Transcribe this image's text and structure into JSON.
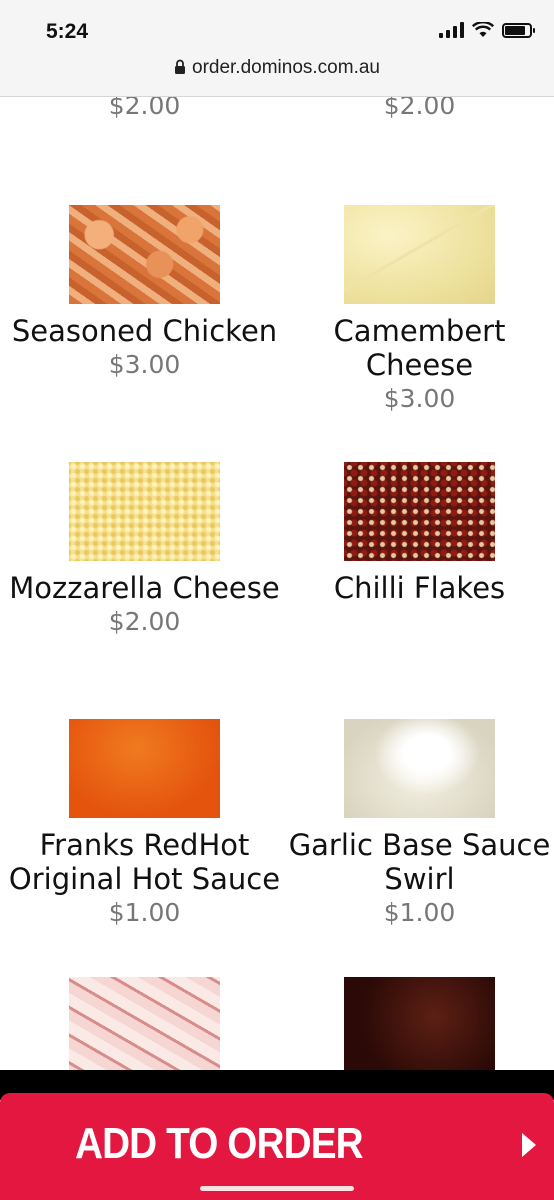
{
  "status_bar": {
    "time": "5:24"
  },
  "browser": {
    "url": "order.dominos.com.au"
  },
  "top_prices": {
    "left": "$2.00",
    "right": "$2.00"
  },
  "toppings": [
    {
      "name": "Seasoned Chicken",
      "price": "$3.00",
      "icon": "seasoned-chicken-image"
    },
    {
      "name": "Camembert Cheese",
      "price": "$3.00",
      "icon": "camembert-cheese-image"
    },
    {
      "name": "Mozzarella Cheese",
      "price": "$2.00",
      "icon": "mozzarella-cheese-image"
    },
    {
      "name": "Chilli Flakes",
      "price": "",
      "icon": "chilli-flakes-image"
    },
    {
      "name": "Franks RedHot Original Hot Sauce",
      "price": "$1.00",
      "icon": "franks-hot-sauce-image"
    },
    {
      "name": "Garlic Base Sauce Swirl",
      "price": "$1.00",
      "icon": "garlic-sauce-image"
    },
    {
      "name": "",
      "price": "",
      "icon": "ham-image"
    },
    {
      "name": "",
      "price": "",
      "icon": "dark-topping-image"
    }
  ],
  "action": {
    "add_to_order": "ADD TO ORDER"
  }
}
